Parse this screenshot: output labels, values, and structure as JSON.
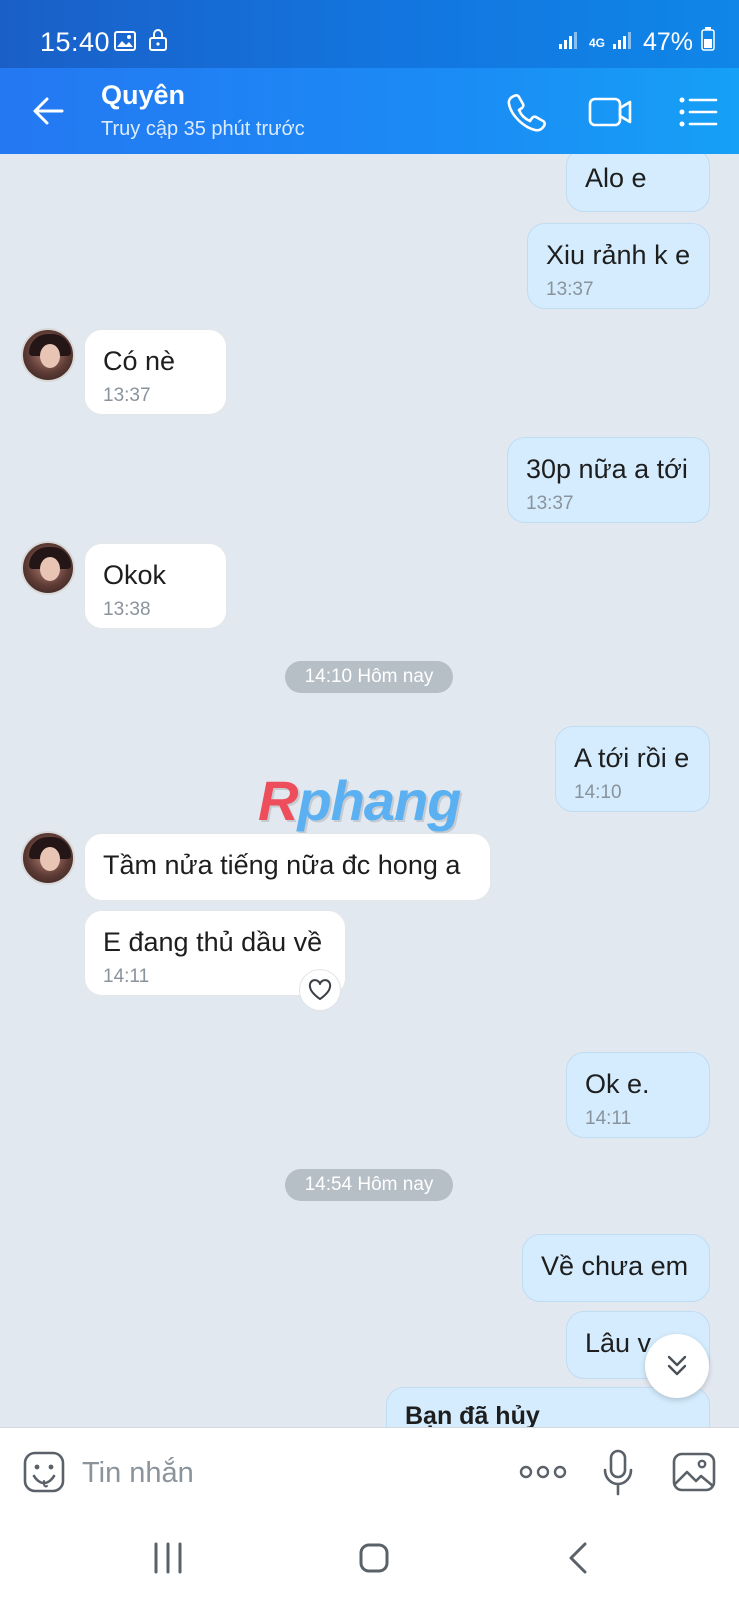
{
  "status_bar": {
    "time": "15:40",
    "network": "4G",
    "battery": "47%"
  },
  "header": {
    "contact_name": "Quyên",
    "contact_status": "Truy cập 35 phút trước"
  },
  "messages": [
    {
      "sender": "me",
      "text": "Alo e",
      "time": ""
    },
    {
      "sender": "me",
      "text": "Xiu rảnh k e",
      "time": "13:37"
    },
    {
      "sender": "contact",
      "text": "Có nè",
      "time": "13:37"
    },
    {
      "sender": "me",
      "text": "30p nữa a tới",
      "time": "13:37"
    },
    {
      "sender": "contact",
      "text": "Okok",
      "time": "13:38"
    },
    {
      "sender": "me",
      "text": "A tới rồi e",
      "time": "14:10"
    },
    {
      "sender": "contact",
      "text": "Tầm nửa tiếng nữa đc hong a",
      "time": ""
    },
    {
      "sender": "contact",
      "text": "E đang thủ dầu về",
      "time": "14:11"
    },
    {
      "sender": "me",
      "text": "Ok e.",
      "time": "14:11"
    },
    {
      "sender": "me",
      "text": "Về chưa em",
      "time": ""
    },
    {
      "sender": "me",
      "text": "Lâu v",
      "time": ""
    },
    {
      "sender": "me",
      "text": "Bạn đã hủy",
      "time": ""
    }
  ],
  "date_separators": [
    "14:10 Hôm nay",
    "14:54 Hôm nay"
  ],
  "watermark": {
    "first": "R",
    "rest": "phang"
  },
  "input": {
    "placeholder": "Tin nhắn"
  },
  "colors": {
    "header": "#1b8bf5",
    "my_bubble": "#d4ecfd",
    "their_bubble": "#ffffff",
    "chat_bg": "#e2e8ef"
  },
  "icons": [
    "back-arrow-icon",
    "phone-icon",
    "video-call-icon",
    "menu-list-icon",
    "heart-icon",
    "chevron-double-down-icon",
    "sticker-icon",
    "more-icon",
    "microphone-icon",
    "image-icon"
  ]
}
